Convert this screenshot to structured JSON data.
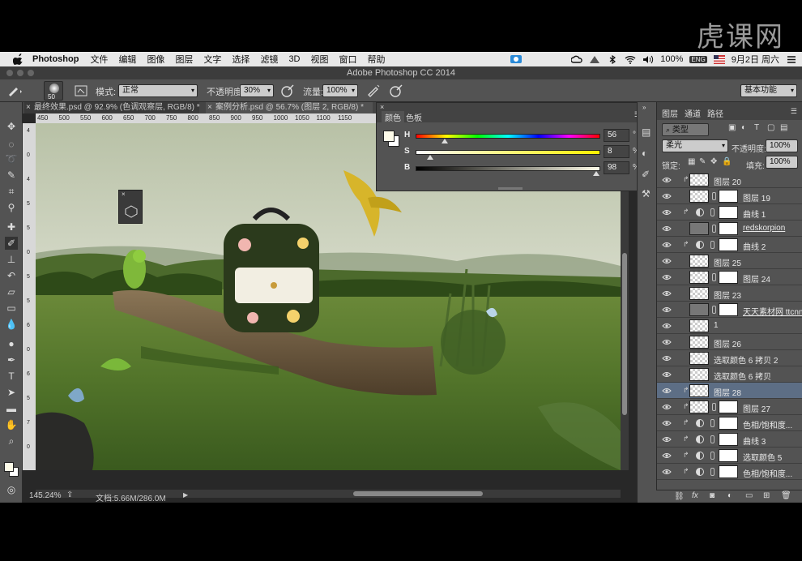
{
  "watermark": "虎课网",
  "menubar": {
    "app": "Photoshop",
    "items": [
      "文件",
      "编辑",
      "图像",
      "图层",
      "文字",
      "选择",
      "滤镜",
      "3D",
      "视图",
      "窗口",
      "帮助"
    ],
    "battery": "100%",
    "battery_badge": "ENG",
    "date": "9月2日 周六"
  },
  "window_title": "Adobe Photoshop CC 2014",
  "options": {
    "brush_size": "50",
    "mode_label": "模式:",
    "mode_value": "正常",
    "opacity_label": "不透明度:",
    "opacity_value": "30%",
    "flow_label": "流量:",
    "flow_value": "100%",
    "workspace": "基本功能"
  },
  "tabs": [
    {
      "label": "最终效果.psd @ 92.9% (色调观察层, RGB/8) *"
    },
    {
      "label": "案例分析.psd @ 56.7% (图层 2, RGB/8) *"
    }
  ],
  "ruler_top": [
    "450",
    "500",
    "550",
    "600",
    "650",
    "700",
    "750",
    "800",
    "850",
    "900",
    "950",
    "1000",
    "1050",
    "1100",
    "1150"
  ],
  "ruler_left": [
    "4",
    "0",
    "4",
    "5",
    "5",
    "0",
    "5",
    "5",
    "6",
    "0",
    "6",
    "5",
    "7",
    "0"
  ],
  "status": {
    "zoom": "145.24%",
    "doc": "文档:5.66M/286.0M"
  },
  "color_panel": {
    "tab_color": "颜色",
    "tab_swatches": "色板",
    "sliders": [
      {
        "letter": "H",
        "value": "56",
        "unit": "°",
        "fraction": 0.16
      },
      {
        "letter": "S",
        "value": "8",
        "unit": "%",
        "fraction": 0.08
      },
      {
        "letter": "B",
        "value": "98",
        "unit": "%",
        "fraction": 0.98
      }
    ]
  },
  "layers_panel": {
    "tab_layers": "图层",
    "tab_channels": "通道",
    "tab_paths": "路径",
    "filter_kind": "类型",
    "blend_mode": "柔光",
    "opacity_label": "不透明度:",
    "opacity_value": "100%",
    "lock_label": "锁定:",
    "fill_label": "填充:",
    "fill_value": "100%",
    "layers": [
      {
        "name": "图层 20",
        "kind": "pixel",
        "clip": true
      },
      {
        "name": "图层 19",
        "kind": "pixel-mask",
        "clip": false
      },
      {
        "name": "曲线 1",
        "kind": "adjust",
        "clip": true
      },
      {
        "name": "redskorpion",
        "kind": "smart",
        "clip": false,
        "underline": true
      },
      {
        "name": "曲线 2",
        "kind": "adjust",
        "clip": true
      },
      {
        "name": "图层 25",
        "kind": "pixel",
        "clip": false
      },
      {
        "name": "图层 24",
        "kind": "pixel-mask",
        "clip": false
      },
      {
        "name": "图层 23",
        "kind": "pixel",
        "clip": false
      },
      {
        "name": "天天素材网 ttcnn.com/...",
        "kind": "smart",
        "clip": false,
        "underline": true
      },
      {
        "name": "1",
        "kind": "pixel",
        "clip": false
      },
      {
        "name": "图层 26",
        "kind": "pixel",
        "clip": false
      },
      {
        "name": "选取颜色 6 拷贝 2",
        "kind": "pixel",
        "clip": false
      },
      {
        "name": "选取颜色 6 拷贝",
        "kind": "pixel",
        "clip": false
      },
      {
        "name": "图层 28",
        "kind": "pixel",
        "clip": true,
        "selected": true
      },
      {
        "name": "图层 27",
        "kind": "pixel-mask",
        "clip": true
      },
      {
        "name": "色相/饱和度...",
        "kind": "adjust",
        "clip": true
      },
      {
        "name": "曲线 3",
        "kind": "adjust",
        "clip": true
      },
      {
        "name": "选取颜色 5",
        "kind": "adjust",
        "clip": true
      },
      {
        "name": "色相/饱和度...",
        "kind": "adjust",
        "clip": true
      }
    ]
  }
}
